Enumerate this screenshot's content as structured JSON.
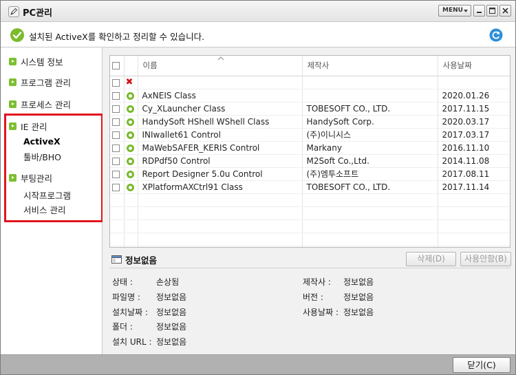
{
  "window": {
    "title": "PC관리",
    "menu_label": "MENU"
  },
  "infobar": {
    "message": "설치된 ActiveX를 확인하고 정리할 수 있습니다."
  },
  "sidebar": {
    "items": [
      {
        "label": "시스템 정보"
      },
      {
        "label": "프로그램 관리"
      },
      {
        "label": "프로세스 관리"
      },
      {
        "label": "IE 관리"
      },
      {
        "label": "부팅관리"
      }
    ],
    "ie_subitems": [
      {
        "label": "ActiveX",
        "active": true
      },
      {
        "label": "툴바/BHO",
        "active": false
      }
    ],
    "boot_subitems": [
      {
        "label": "시작프로그램"
      },
      {
        "label": "서비스 관리"
      }
    ],
    "highlight_color": "#e0141e"
  },
  "table": {
    "columns": {
      "name": "이름",
      "maker": "제작사",
      "date": "사용날짜"
    },
    "rows": [
      {
        "name": "AxNEIS Class",
        "maker": "",
        "date": "2020.01.26"
      },
      {
        "name": "Cy_XLauncher Class",
        "maker": "TOBESOFT CO., LTD.",
        "date": "2017.11.15"
      },
      {
        "name": "HandySoft HShell WShell Class",
        "maker": "HandySoft Corp.",
        "date": "2020.03.17"
      },
      {
        "name": "INIwallet61 Control",
        "maker": "(주)이니시스",
        "date": "2017.03.17"
      },
      {
        "name": "MaWebSAFER_KERIS Control",
        "maker": "Markany",
        "date": "2016.11.10"
      },
      {
        "name": "RDPdf50 Control",
        "maker": "M2Soft Co.,Ltd.",
        "date": "2014.11.08"
      },
      {
        "name": "Report Designer 5.0u Control",
        "maker": "(주)엠투소프트",
        "date": "2017.08.11"
      },
      {
        "name": "XPlatformAXCtrl91 Class",
        "maker": "TOBESOFT CO., LTD.",
        "date": "2017.11.14"
      }
    ],
    "status_color": "#78b92c"
  },
  "detail": {
    "title": "정보없음",
    "delete_label": "삭제(D)",
    "unused_label": "사용안함(B)",
    "fields": {
      "status": {
        "label": "상태 :",
        "value": "손상됨"
      },
      "filename": {
        "label": "파일명 :",
        "value": "정보없음"
      },
      "install_date": {
        "label": "설치날짜 :",
        "value": "정보없음"
      },
      "folder": {
        "label": "폴더 :",
        "value": "정보없음"
      },
      "install_url": {
        "label": "설치 URL :",
        "value": "정보없음"
      },
      "maker": {
        "label": "제작사 :",
        "value": "정보없음"
      },
      "version": {
        "label": "버전 :",
        "value": "정보없음"
      },
      "use_date": {
        "label": "사용날짜 :",
        "value": "정보없음"
      }
    }
  },
  "footer": {
    "close_label": "닫기(C)"
  }
}
